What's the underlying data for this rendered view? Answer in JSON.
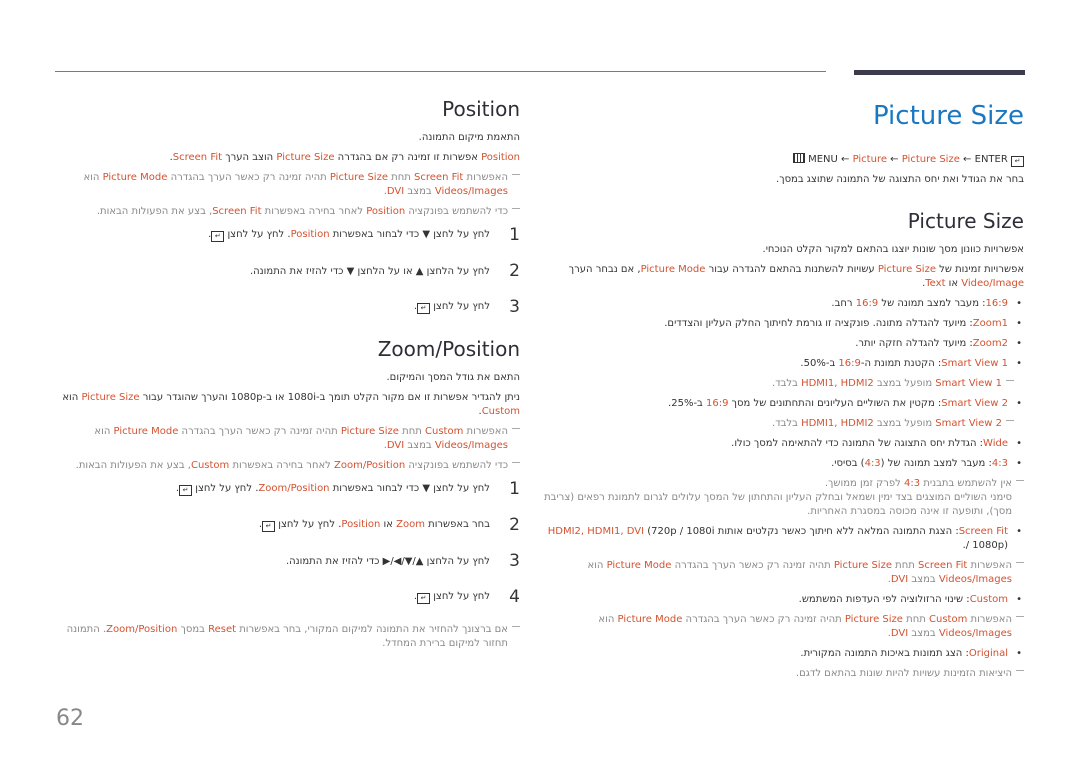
{
  "page_number": "62",
  "right": {
    "title": "Picture Size",
    "breadcrumb": {
      "enter": "ENTER",
      "arrow": "←",
      "picture_size": "Picture Size",
      "picture": "Picture",
      "menu": "MENU",
      "enter_icon": "enter-key-icon",
      "menu_icon": "menu-key-icon"
    },
    "intro": "בחר את הגודל ואת יחס התצוגה של התמונה שתוצג במסך.",
    "section_title": "Picture Size",
    "p1": "אפשרויות כוונון מסך שונות יוצגו בהתאם למקור הקלט הנוכחי.",
    "p2": {
      "a": "אפשרויות זמינות של ",
      "b": "Picture Size",
      "c": " עשויות להשתנות בהתאם להגדרה עבור ",
      "d": "Picture Mode",
      "e": ", אם נבחר הערך ",
      "f": "Video/Image",
      "g": " או ",
      "h": "Text",
      "i": "."
    },
    "items": {
      "i169": {
        "k": "16:9",
        "t1": ": מעבר למצב תמונה של ",
        "v": "16:9",
        "t2": " רחב."
      },
      "zoom1": {
        "k": "Zoom1",
        "t": ": מיועד להגדלה מתונה. פונקציה זו גורמת לחיתוך החלק העליון והצדדים."
      },
      "zoom2": {
        "k": "Zoom2",
        "t": ": מיועד להגדלה חזקה יותר."
      },
      "sv1": {
        "k": "Smart View 1",
        "t1": ": הקטנת תמונת ה-",
        "v": "16:9",
        "t2": " ב-50%."
      },
      "sv1_note": {
        "k": "Smart View 1",
        "t1": " מופעל במצב ",
        "v": "HDMI1, HDMI2",
        "t2": " בלבד."
      },
      "sv2": {
        "k": "Smart View 2",
        "t1": ": מקטין את השוליים העליונים והתחתונים של מסך ",
        "v": "16:9",
        "t2": " ב-25%."
      },
      "sv2_note": {
        "k": "Smart View 2",
        "t1": " מופעל במצב ",
        "v": "HDMI1, HDMI2",
        "t2": " בלבד."
      },
      "wide": {
        "k": "Wide",
        "t": ": הגדלת יחס התצוגה של התמונה כדי להתאימה למסך כולו."
      },
      "r43": {
        "k": "4:3",
        "t1": ": מעבר למצב תמונה של (",
        "v": "4:3",
        "t2": ") בסיסי."
      },
      "r43_note": {
        "t1": "אין להשתמש בתבנית ",
        "v": "4:3",
        "t2": " לפרק זמן ממושך.",
        "t3": "סימני השוליים המוצגים בצד ימין ושמאל ובחלק העליון והתחתון של המסך עלולים לגרום לתמונת רפאים (צריבת מסך), ותופעה זו אינה מכוסה במסגרת האחריות."
      },
      "fit": {
        "k": "Screen Fit",
        "t1": ": הצגת התמונה המלאה ללא חיתוך כאשר נקלטים אותות ",
        "v": "HDMI2, HDMI1, DVI",
        "t2": " (720p / 1080i / 1080p)."
      },
      "fit_note": {
        "a": "האפשרות ",
        "b": "Screen Fit",
        "c": " תחת ",
        "d": "Picture Size",
        "e": " תהיה זמינה רק כאשר הערך בהגדרה ",
        "f": "Picture Mode",
        "g": " הוא ",
        "h": "Videos/Images",
        "i": " במצב ",
        "j": "DVI",
        "k": "."
      },
      "custom": {
        "k": "Custom",
        "t": ": שינוי הרזולוציה לפי העדפות המשתמש."
      },
      "custom_note": {
        "a": "האפשרות ",
        "b": "Custom",
        "c": " תחת ",
        "d": "Picture Size",
        "e": " תהיה זמינה רק כאשר הערך בהגדרה ",
        "f": "Picture Mode",
        "g": " הוא ",
        "h": "Videos/Images",
        "i": " במצב ",
        "j": "DVI",
        "k": "."
      },
      "original": {
        "k": "Original",
        "t": ": הצג תמונות באיכות התמונה המקורית."
      },
      "original_note": "היציאות הזמינות עשויות להיות שונות בהתאם לדגם."
    }
  },
  "left": {
    "position": {
      "title": "Position",
      "p1": "התאמת מיקום התמונה.",
      "p2": {
        "a": "Position",
        "b": " אפשרות זו זמינה רק אם בהגדרה ",
        "c": "Picture Size",
        "d": " הוצב הערך ",
        "e": "Screen Fit",
        "f": "."
      },
      "note1": {
        "a": "האפשרות ",
        "b": "Screen Fit",
        "c": " תחת ",
        "d": "Picture Size",
        "e": " תהיה זמינה רק כאשר הערך בהגדרה ",
        "f": "Picture Mode",
        "g": " הוא ",
        "h": "Videos/Images",
        "i": " במצב ",
        "j": "DVI",
        "k": "."
      },
      "note2": {
        "a": "כדי להשתמש בפונקציה ",
        "b": "Position",
        "c": " לאחר בחירה באפשרות ",
        "d": "Screen Fit",
        "e": ", בצע את הפעולות הבאות."
      },
      "steps": [
        {
          "n": "1",
          "a": "לחץ על לחצן ▼ כדי לבחור באפשרות ",
          "b": "Position",
          "c": ". לחץ על לחצן ",
          "d": "."
        },
        {
          "n": "2",
          "a": "לחץ על הלחצן ▲ או על הלחצן ▼ כדי להזיז את התמונה.",
          "b": "",
          "c": "",
          "d": ""
        },
        {
          "n": "3",
          "a": "לחץ על לחצן ",
          "b": "",
          "c": "",
          "d": "."
        }
      ]
    },
    "zoom_position": {
      "title": "Zoom/Position",
      "p1": "התאם את גודל המסך והמיקום.",
      "p2": {
        "a": "ניתן להגדיר אפשרות זו אם מקור הקלט תומך ב-1080i או ב-1080p והערך שהוגדר עבור ",
        "b": "Picture Size",
        "c": " הוא ",
        "d": "Custom",
        "e": "."
      },
      "note1": {
        "a": "האפשרות ",
        "b": "Custom",
        "c": " תחת ",
        "d": "Picture Size",
        "e": " תהיה זמינה רק כאשר הערך בהגדרה ",
        "f": "Picture Mode",
        "g": " הוא ",
        "h": "Videos/Images",
        "i": " במצב ",
        "j": "DVI",
        "k": "."
      },
      "note2": {
        "a": "כדי להשתמש בפונקציה ",
        "b": "Zoom/Position",
        "c": " לאחר בחירה באפשרות ",
        "d": "Custom",
        "e": ", בצע את הפעולות הבאות."
      },
      "steps": [
        {
          "n": "1",
          "a": "לחץ על לחצן ▼ כדי לבחור באפשרות ",
          "b": "Zoom/Position",
          "c": ". לחץ על לחצן ",
          "d": "."
        },
        {
          "n": "2",
          "a": "בחר באפשרות ",
          "b": "Zoom",
          "c": " או ",
          "d": "Position",
          "e": ". לחץ על לחצן ",
          "f": "."
        },
        {
          "n": "3",
          "a": "לחץ על הלחצן ▲/▼/◀/▶ כדי להזיז את התמונה."
        },
        {
          "n": "4",
          "a": "לחץ על לחצן ",
          "d": "."
        }
      ],
      "note3": {
        "a": "אם ברצונך להחזיר את התמונה למיקום המקורי, בחר באפשרות ",
        "b": "Reset",
        "c": " במסך ",
        "d": "Zoom/Position",
        "e": ". התמונה תחזור למיקום ברירת המחדל."
      }
    }
  }
}
